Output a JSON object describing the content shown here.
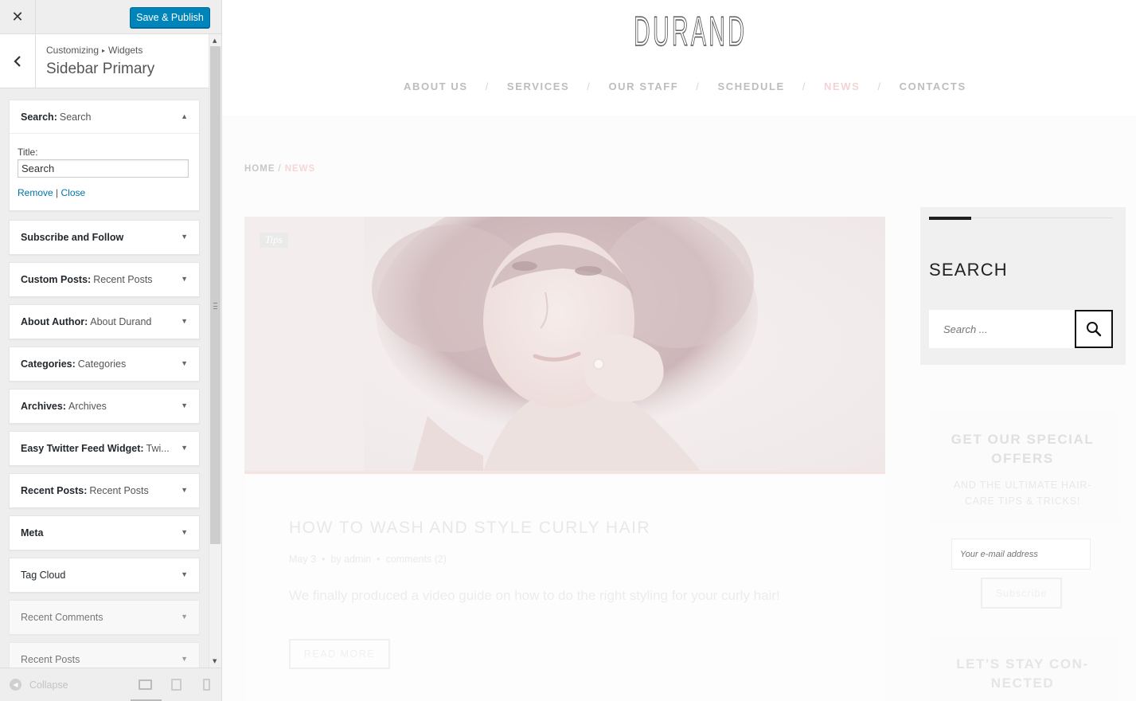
{
  "customizer": {
    "close_label": "✕",
    "save_label": "Save & Publish",
    "breadcrumb": {
      "root": "Customizing",
      "separator": "▸",
      "current": "Widgets"
    },
    "section_title": "Sidebar Primary",
    "search_widget": {
      "title": "Search:",
      "subtitle": "Search",
      "field_label": "Title:",
      "field_value": "Search",
      "remove_label": "Remove",
      "divider": "|",
      "close_label": "Close"
    },
    "widgets": [
      {
        "title": "Subscribe and Follow",
        "subtitle": ""
      },
      {
        "title": "Custom Posts:",
        "subtitle": "Recent Posts"
      },
      {
        "title": "About Author:",
        "subtitle": "About Durand"
      },
      {
        "title": "Categories:",
        "subtitle": "Categories"
      },
      {
        "title": "Archives:",
        "subtitle": "Archives"
      },
      {
        "title": "Easy Twitter Feed Widget:",
        "subtitle": "Twi..."
      },
      {
        "title": "Recent Posts:",
        "subtitle": "Recent Posts"
      },
      {
        "title": "Meta",
        "subtitle": ""
      },
      {
        "title": "Tag Cloud",
        "subtitle": ""
      },
      {
        "title": "Recent Comments",
        "subtitle": ""
      },
      {
        "title": "Recent Posts",
        "subtitle": ""
      }
    ],
    "footer": {
      "collapse_label": "Collapse"
    }
  },
  "site": {
    "logo": "DURAND",
    "nav": [
      "ABOUT US",
      "SERVICES",
      "OUR STAFF",
      "SCHEDULE",
      "NEWS",
      "CONTACTS"
    ],
    "nav_separator": "/",
    "active_nav": "NEWS",
    "breadcrumbs": {
      "home": "HOME",
      "separator": "/",
      "current": "NEWS"
    },
    "post": {
      "tag": "Tips",
      "title": "HOW TO WASH AND STYLE CURLY HAIR",
      "date": "May 3",
      "by": "by",
      "author": "admin",
      "comments": "comments (2)",
      "meta_dot": "•",
      "excerpt": "We finally produced a video guide on how to do the right styling for your curly hair!",
      "read_more": "READ MORE"
    },
    "search_widget": {
      "title": "SEARCH",
      "placeholder": "Search ..."
    },
    "offers_widget": {
      "title_line1": "GET OUR SPECIAL",
      "title_line2": "OFFERS",
      "sub_line1": "AND THE ULTIMATE HAIR-",
      "sub_line2": "CARE TIPS & TRICKS!",
      "email_placeholder": "Your e-mail address",
      "subscribe": "Subscribe"
    },
    "stay_widget": {
      "title_line1": "LET'S STAY CON-",
      "title_line2": "NECTED"
    }
  },
  "colors": {
    "primary_button": "#0085ba",
    "link": "#0073aa",
    "nav_active": "#f3d3d3"
  },
  "icons": {
    "close": "close-icon",
    "back": "chevron-left-icon",
    "widget_toggle_open": "triangle-up-icon",
    "widget_toggle_closed": "triangle-down-icon",
    "search": "search-icon",
    "collapse": "collapse-arrow-icon",
    "devices": [
      "desktop-icon",
      "tablet-icon",
      "mobile-icon"
    ]
  }
}
